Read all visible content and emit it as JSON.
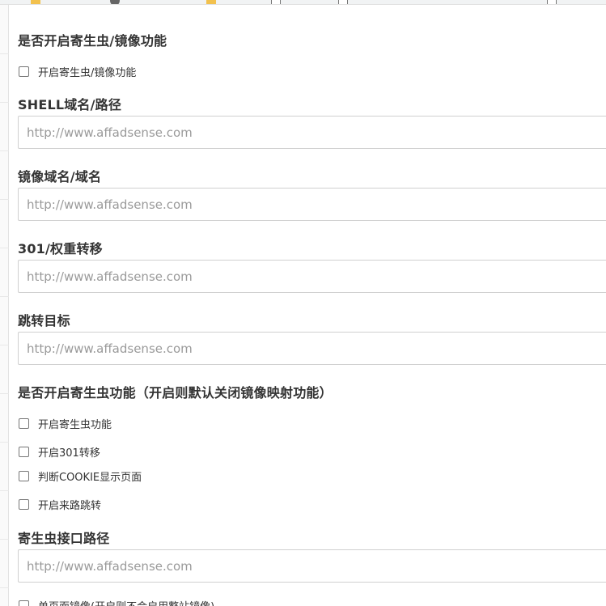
{
  "bookmarks": [
    {
      "icon": "folder-icon"
    },
    {
      "icon": "settings-icon"
    },
    {
      "icon": "folder-icon"
    },
    {
      "icon": "page-icon"
    },
    {
      "icon": "page-icon"
    },
    {
      "icon": "page-icon"
    }
  ],
  "spider_mirror": {
    "title": "是否开启寄生虫/镜像功能",
    "checkbox_label": "开启寄生虫/镜像功能"
  },
  "shell_domain": {
    "title": "SHELL域名/路径",
    "placeholder": "http://www.affadsense.com"
  },
  "mirror_domain": {
    "title": "镜像域名/域名",
    "placeholder": "http://www.affadsense.com"
  },
  "redirect_301": {
    "title": "301/权重转移",
    "placeholder": "http://www.affadsense.com"
  },
  "jump_target": {
    "title": "跳转目标",
    "placeholder": "http://www.affadsense.com"
  },
  "spider_options": {
    "title": "是否开启寄生虫功能（开启则默认关闭镜像映射功能）",
    "checkboxes": [
      {
        "label": "开启寄生虫功能",
        "checked": false
      },
      {
        "label": "开启301转移",
        "checked": false
      },
      {
        "label": "判断COOKIE显示页面",
        "checked": false
      },
      {
        "label": "开启来路跳转",
        "checked": false
      }
    ]
  },
  "spider_api": {
    "title": "寄生虫接口路径",
    "placeholder": "http://www.affadsense.com"
  },
  "single_page_mirror": {
    "label": "单页面镜像(开启则不会启用整站镜像)"
  }
}
